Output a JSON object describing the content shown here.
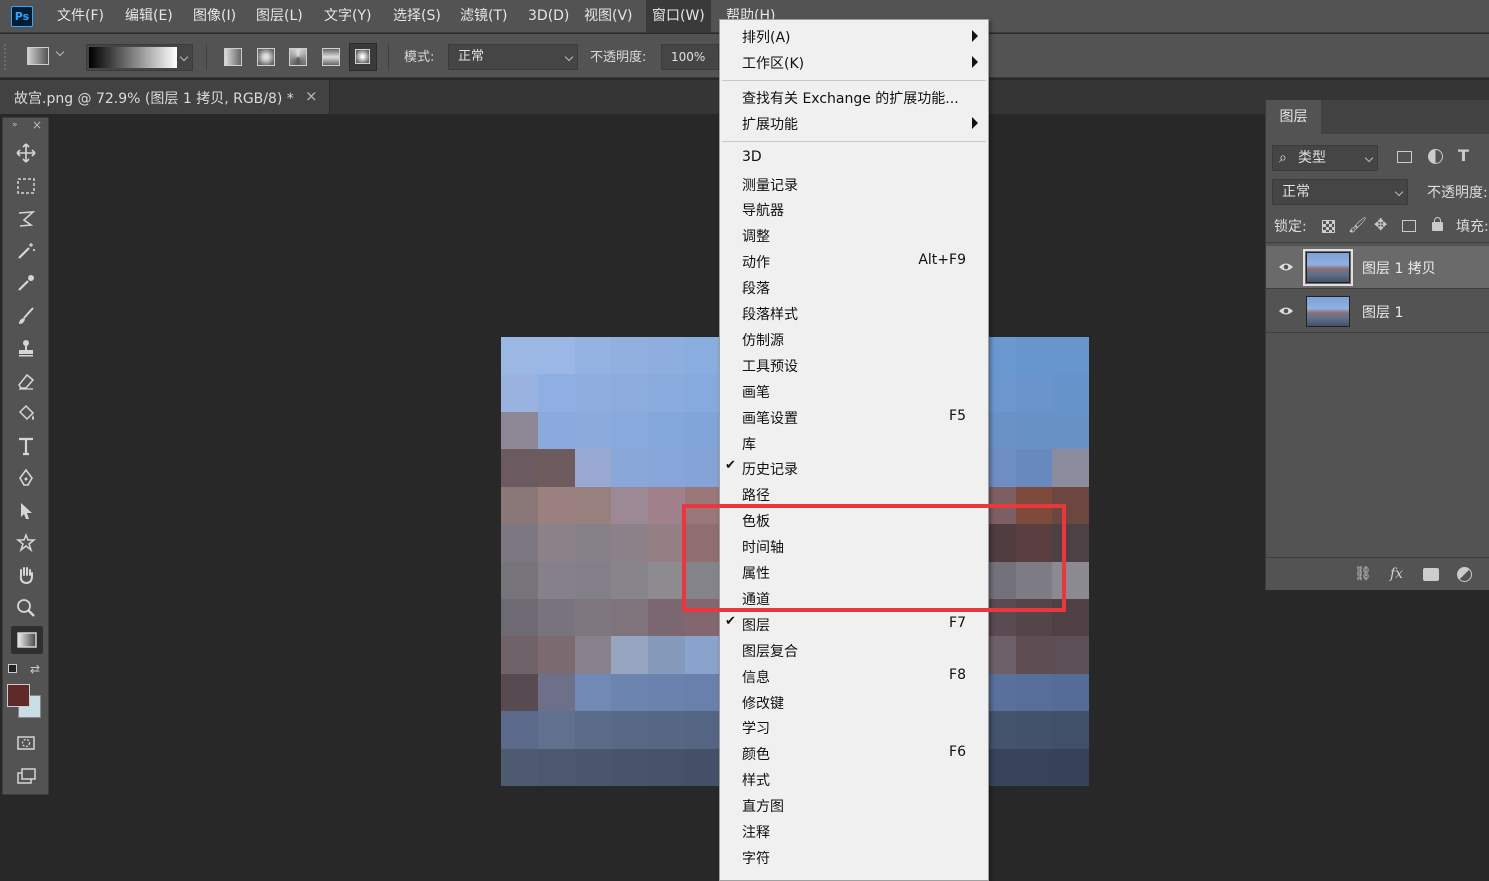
{
  "app": {
    "logo_text": "Ps",
    "menus": [
      "文件(F)",
      "编辑(E)",
      "图像(I)",
      "图层(L)",
      "文字(Y)",
      "选择(S)",
      "滤镜(T)",
      "3D(D)",
      "视图(V)",
      "窗口(W)",
      "帮助(H)"
    ],
    "active_menu_index": 9
  },
  "options": {
    "mode_label": "模式:",
    "mode_value": "正常",
    "opacity_label": "不透明度:",
    "opacity_value": "100%"
  },
  "document": {
    "tab_title": "故宫.png @ 72.9% (图层 1 拷贝, RGB/8) *",
    "close_glyph": "×"
  },
  "window_menu": {
    "items": [
      {
        "label": "排列(A)",
        "submenu": true
      },
      {
        "label": "工作区(K)",
        "submenu": true
      },
      {
        "separator": true
      },
      {
        "label": "查找有关 Exchange 的扩展功能..."
      },
      {
        "label": "扩展功能",
        "submenu": true
      },
      {
        "separator": true
      },
      {
        "label": "3D"
      },
      {
        "label": "测量记录"
      },
      {
        "label": "导航器"
      },
      {
        "label": "调整"
      },
      {
        "label": "动作",
        "shortcut": "Alt+F9"
      },
      {
        "label": "段落"
      },
      {
        "label": "段落样式"
      },
      {
        "label": "仿制源"
      },
      {
        "label": "工具预设"
      },
      {
        "label": "画笔"
      },
      {
        "label": "画笔设置",
        "shortcut": "F5"
      },
      {
        "label": "库"
      },
      {
        "label": "历史记录",
        "checked": true
      },
      {
        "label": "路径"
      },
      {
        "label": "色板"
      },
      {
        "label": "时间轴"
      },
      {
        "label": "属性"
      },
      {
        "label": "通道"
      },
      {
        "label": "图层",
        "shortcut": "F7",
        "checked": true
      },
      {
        "label": "图层复合"
      },
      {
        "label": "信息",
        "shortcut": "F8"
      },
      {
        "label": "修改键"
      },
      {
        "label": "学习"
      },
      {
        "label": "颜色",
        "shortcut": "F6"
      },
      {
        "label": "样式"
      },
      {
        "label": "直方图"
      },
      {
        "label": "注释"
      },
      {
        "label": "字符"
      }
    ]
  },
  "layers_panel": {
    "tab_label": "图层",
    "filter_value": "类型",
    "blend_value": "正常",
    "opacity_label": "不透明度:",
    "lock_label": "锁定:",
    "fill_label": "填充:",
    "layers": [
      {
        "name": "图层 1 拷贝",
        "selected": true
      },
      {
        "name": "图层 1",
        "selected": false
      }
    ]
  },
  "colors": {
    "foreground": "#5e2a2a",
    "background": "#c9dde4",
    "highlight": "#e8383d"
  }
}
